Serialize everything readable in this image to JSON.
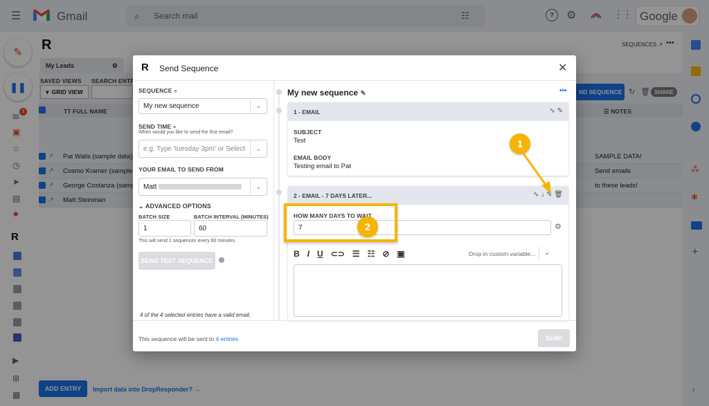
{
  "gmail": {
    "app_name": "Gmail",
    "search_placeholder": "Search mail",
    "google": "Google"
  },
  "rail": {
    "mail_badge": "3"
  },
  "dropresponder": {
    "sequences_link": "SEQUENCES ↗",
    "tabs": [
      "My Leads"
    ],
    "saved_views_label": "SAVED VIEWS",
    "search_label": "SEARCH ENTRI",
    "grid_view": "GRID VIEW",
    "send_sequence_btn": "ND SEQUENCE",
    "share": "SHARE",
    "col_full_name": "FULL NAME",
    "col_notes": "NOTES",
    "rows": [
      {
        "name": "Pat Walls (sample data)",
        "note": "SAMPLE DATA!"
      },
      {
        "name": "Cosmo Kramer (sample data",
        "note": "Send emails"
      },
      {
        "name": "George Costanza (sample",
        "note": "to these leads!"
      },
      {
        "name": "Matt Steinman",
        "note": ""
      }
    ],
    "add_entry": "ADD ENTRY",
    "import_link": "Import data into DropResponder? →"
  },
  "modal": {
    "title": "Send Sequence",
    "left": {
      "sequence_label": "SEQUENCE",
      "sequence_value": "My new sequence",
      "send_time_label": "SEND TIME",
      "send_time_hint": "When would you like to send the first email?",
      "send_time_placeholder": "e.g. Type 'tuesday 3pm' or Select",
      "your_email_label": "YOUR EMAIL TO SEND FROM",
      "your_email_value": "Matt",
      "advanced": "ADVANCED OPTIONS",
      "batch_size_label": "BATCH SIZE",
      "batch_size": "1",
      "batch_interval_label": "BATCH INTERVAL (MINUTES)",
      "batch_interval": "60",
      "batch_note": "This will send 1 sequences every 60 minutes.",
      "send_test": "SEND TEST SEQUENCE",
      "valid_note": "4 of the 4 selected entries have a valid email."
    },
    "right": {
      "seq_name": "My new sequence",
      "email1_header": "1 - EMAIL",
      "subject_label": "SUBJECT",
      "subject": "Test",
      "body_label": "EMAIL BODY",
      "body": "Testing email to Pat",
      "email2_header": "2 - EMAIL - 7 DAYS LATER...",
      "wait_label": "HOW MANY DAYS TO WAIT",
      "wait_value": "7",
      "custom_var": "Drop in custom variable...",
      "annot1": "1",
      "annot2": "2"
    },
    "footer": {
      "text": "This sequence will be sent to",
      "entries": "4 entries",
      "send": "SEND"
    }
  },
  "colors": {
    "accent": "#1a73e8",
    "annotation": "#f5b400",
    "gmail_red": "#ea4335"
  }
}
